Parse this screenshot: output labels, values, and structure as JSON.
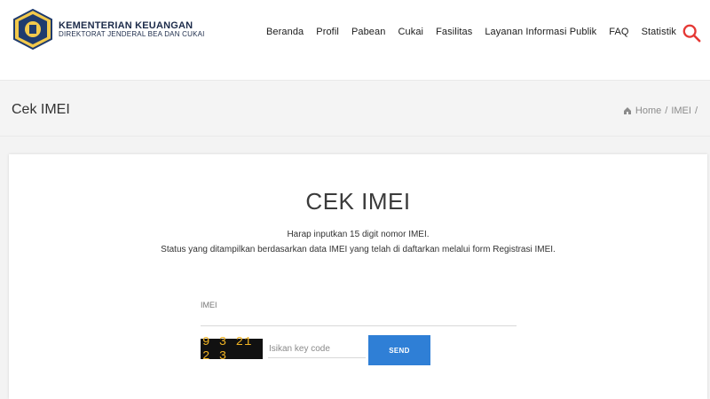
{
  "header": {
    "logo_title": "KEMENTERIAN KEUANGAN",
    "logo_subtitle": "DIREKTORAT JENDERAL BEA DAN CUKAI",
    "nav": [
      "Beranda",
      "Profil",
      "Pabean",
      "Cukai",
      "Fasilitas",
      "Layanan Informasi Publik",
      "FAQ",
      "Statistik"
    ],
    "search_icon": "search-icon"
  },
  "title_strip": {
    "title": "Cek IMEI",
    "breadcrumb": [
      "Home",
      "IMEI"
    ],
    "home_icon": "home-icon"
  },
  "card": {
    "title": "CEK IMEI",
    "desc1": "Harap inputkan 15 digit nomor IMEI.",
    "desc2": "Status yang ditampilkan berdasarkan data IMEI yang telah di daftarkan melalui form Registrasi IMEI.",
    "imei_label": "IMEI",
    "captcha": "9 3 21 2 3",
    "keycode_placeholder": "Isikan key code",
    "send_label": "SEND"
  },
  "colors": {
    "accent": "#2f7fd6",
    "search": "#e53935",
    "captcha_bg": "#111111",
    "captcha_text": "#f0b323"
  }
}
